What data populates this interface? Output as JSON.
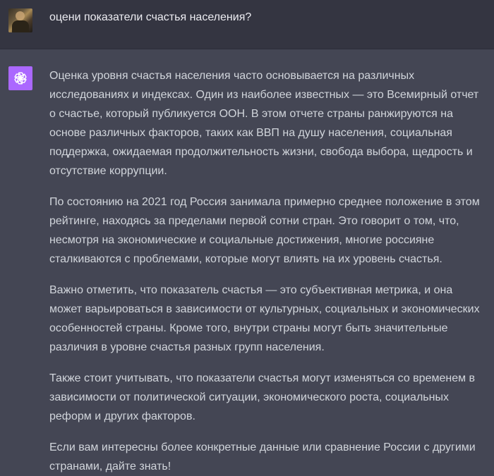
{
  "user_message": {
    "avatar": "user-avatar-portrait",
    "text": "оцени показатели счастья населения?"
  },
  "assistant_message": {
    "avatar": "openai-logo-icon",
    "accent_color": "#ab68ff",
    "paragraphs": [
      "Оценка уровня счастья населения часто основывается на различных исследованиях и индексах. Один из наиболее известных — это Всемирный отчет о счастье, который публикуется ООН. В этом отчете страны ранжируются на основе различных факторов, таких как ВВП на душу населения, социальная поддержка, ожидаемая продолжительность жизни, свобода выбора, щедрость и отсутствие коррупции.",
      "По состоянию на 2021 год Россия занимала примерно среднее положение в этом рейтинге, находясь за пределами первой сотни стран. Это говорит о том, что, несмотря на экономические и социальные достижения, многие россияне сталкиваются с проблемами, которые могут влиять на их уровень счастья.",
      "Важно отметить, что показатель счастья — это субъективная метрика, и она может варьироваться в зависимости от культурных, социальных и экономических особенностей страны. Кроме того, внутри страны могут быть значительные различия в уровне счастья разных групп населения.",
      "Также стоит учитывать, что показатели счастья могут изменяться со временем в зависимости от политической ситуации, экономического роста, социальных реформ и других факторов.",
      "Если вам интересны более конкретные данные или сравнение России с другими странами, дайте знать!"
    ]
  },
  "colors": {
    "user_bg": "#343541",
    "assistant_bg": "#444654",
    "text": "#d1d5db"
  }
}
